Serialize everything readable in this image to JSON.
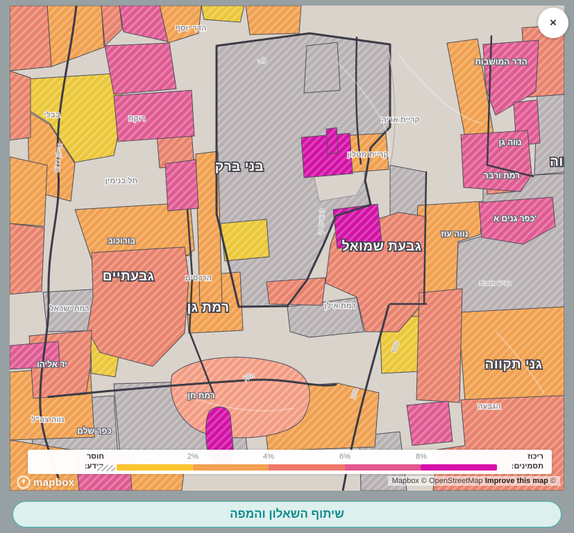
{
  "window": {
    "close_label": "×"
  },
  "share": {
    "label": "שיתוף השאלון והמפה"
  },
  "logo": {
    "text": "mapbox"
  },
  "attribution": {
    "text": "Mapbox © OpenStreetMap",
    "improve": "Improve this map",
    "suffix": "©"
  },
  "legend": {
    "no_data_title": "חוסר",
    "no_data_label": "מידע:",
    "concentration_title": "ריכוז",
    "concentration_label": "תסמינים:",
    "ticks": [
      "2%",
      "4%",
      "6%",
      "8%"
    ],
    "scale_colors": [
      "#fdc42f",
      "#f5a053",
      "#f0796b",
      "#e2588f",
      "#d610aa"
    ]
  },
  "map": {
    "labels": {
      "bnei_brak": "בני ברק",
      "givatayim": "גבעתיים",
      "ramat_gan": "רמת גן",
      "givat_shmuel": "גבעת שמואל",
      "ganei_tikva": "גני תקווה",
      "petah_tikva_partial": "ווה",
      "borochov": "בורוכוב",
      "ramat_verber": "רמת ורבר",
      "kfar_ganim_a": "כפר גנים א'",
      "neve_oz": "נווה עוז",
      "neve_gan": "נווה גן",
      "ramat_chen": "רמת חן",
      "kfar_shalem": "כפר שלם",
      "yad_eliyahu": "יד אליהו",
      "hadar_hamoshavot": "הדר המושבות",
      "kiryat_matalon": "קריית מטלון",
      "hadar_yosef": "הדר יוסף",
      "lehi": "לחי",
      "bavli": "בבלי",
      "rokach": "רוקח",
      "kiryat_arye": "קריית אריה",
      "tel_binyamin": "תל בנימין",
      "ramat_israel": "רמת ישראל",
      "harechasim": "הרכסים",
      "ramat_ilan": "רמת אילן",
      "neve_tzahal": "נווה צה\"ל",
      "hagiva": "הגבעה",
      "kvish_mekabit": "כביש מכבית",
      "hillel_st": "הלל",
      "ayalon_darom": "איילון דרום",
      "jabotinsky": "ז'בוטינסקי",
      "geha": "גהה",
      "kesem": "קסם"
    }
  }
}
